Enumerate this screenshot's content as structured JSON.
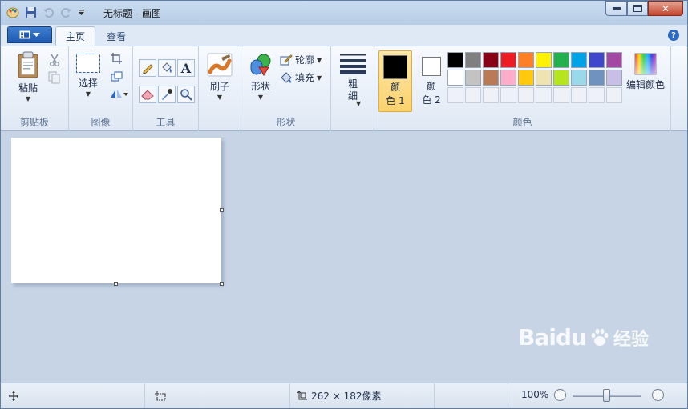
{
  "window": {
    "title": "无标题 - 画图"
  },
  "tabs": [
    {
      "label": "主页"
    },
    {
      "label": "查看"
    }
  ],
  "ribbon": {
    "clipboard": {
      "paste_label": "粘贴",
      "group_label": "剪贴板"
    },
    "image": {
      "select_label": "选择",
      "group_label": "图像"
    },
    "tools": {
      "group_label": "工具"
    },
    "brushes": {
      "label": "刷子"
    },
    "shapes": {
      "shapes_label": "形状",
      "outline_label": "轮廓",
      "fill_label": "填充",
      "group_label": "形状"
    },
    "size": {
      "label_line1": "粗",
      "label_line2": "细"
    },
    "colors": {
      "color1_line1": "颜",
      "color1_line2": "色 1",
      "color1_value": "#000000",
      "color2_line1": "颜",
      "color2_line2": "色 2",
      "color2_value": "#ffffff",
      "edit_label": "编辑颜色",
      "group_label": "颜色",
      "palette_row1": [
        "#000000",
        "#7f7f7f",
        "#880015",
        "#ed1c24",
        "#ff7f27",
        "#fff200",
        "#22b14c",
        "#00a2e8",
        "#3f48cc",
        "#a349a4"
      ],
      "palette_row2": [
        "#ffffff",
        "#c3c3c3",
        "#b97a57",
        "#ffaec9",
        "#ffc90e",
        "#efe4b0",
        "#b5e61d",
        "#99d9ea",
        "#7092be",
        "#c8bfe7"
      ]
    }
  },
  "status": {
    "selection_size": "262 × 182像素",
    "zoom": "100%",
    "zoom_level": 0.5
  },
  "watermark": {
    "brand": "Baidu",
    "cn": "经验"
  }
}
